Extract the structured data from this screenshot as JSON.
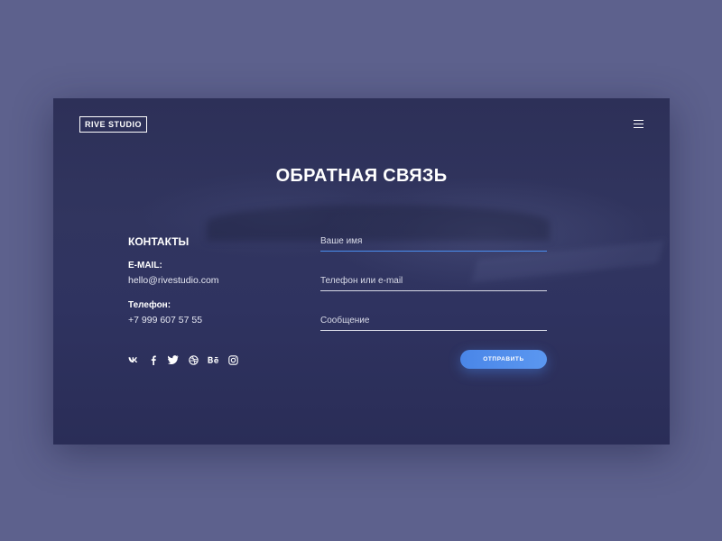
{
  "header": {
    "logo": "RIVE STUDIO",
    "menu_icon": "hamburger-menu-icon"
  },
  "page": {
    "title": "ОБРАТНАЯ СВЯЗЬ"
  },
  "contacts": {
    "heading": "КОНТАКТЫ",
    "email_label": "E-MAIL:",
    "email_value": "hello@rivestudio.com",
    "phone_label": "Телефон:",
    "phone_value": "+7 999 607 57 55"
  },
  "socials": [
    {
      "icon": "vk-icon"
    },
    {
      "icon": "facebook-icon"
    },
    {
      "icon": "twitter-icon"
    },
    {
      "icon": "dribbble-icon"
    },
    {
      "icon": "behance-icon"
    },
    {
      "icon": "instagram-icon"
    }
  ],
  "form": {
    "name_placeholder": "Ваше имя",
    "contact_placeholder": "Телефон или e-mail",
    "message_placeholder": "Сообщение",
    "submit_label": "ОТПРАВИТЬ"
  },
  "colors": {
    "page_background": "#5d618d",
    "card_background": "#2f3360",
    "accent": "#4a8ef0",
    "text": "#ffffff"
  }
}
